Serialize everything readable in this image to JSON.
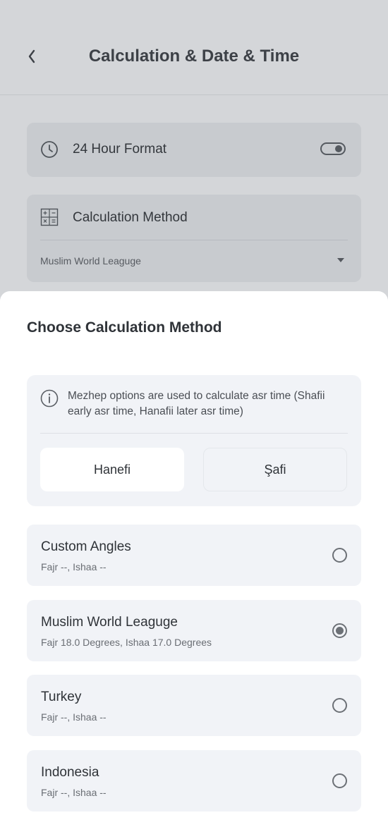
{
  "header": {
    "title": "Calculation & Date & Time"
  },
  "settings": {
    "hour_format": {
      "label": "24 Hour Format",
      "enabled": true
    },
    "calc_method": {
      "label": "Calculation Method",
      "value": "Muslim World Leaguge"
    }
  },
  "sheet": {
    "title": "Choose Calculation Method",
    "info_text": "Mezhep options are used to calculate asr time (Shafii early asr time, Hanafii later asr time)",
    "mezhep": {
      "hanefi": "Hanefi",
      "safi": "Şafi",
      "selected": "Hanefi"
    },
    "options": [
      {
        "name": "Custom Angles",
        "sub": "Fajr --, Ishaa --",
        "selected": false
      },
      {
        "name": "Muslim World Leaguge",
        "sub": "Fajr 18.0 Degrees, Ishaa 17.0 Degrees",
        "selected": true
      },
      {
        "name": "Turkey",
        "sub": "Fajr --, Ishaa --",
        "selected": false
      },
      {
        "name": "Indonesia",
        "sub": "Fajr --, Ishaa --",
        "selected": false
      }
    ]
  },
  "colors": {
    "overlay_bg": "#d4d6d9",
    "sheet_bg": "#ffffff",
    "card_bg": "#f1f3f7",
    "text": "#2f3338"
  }
}
